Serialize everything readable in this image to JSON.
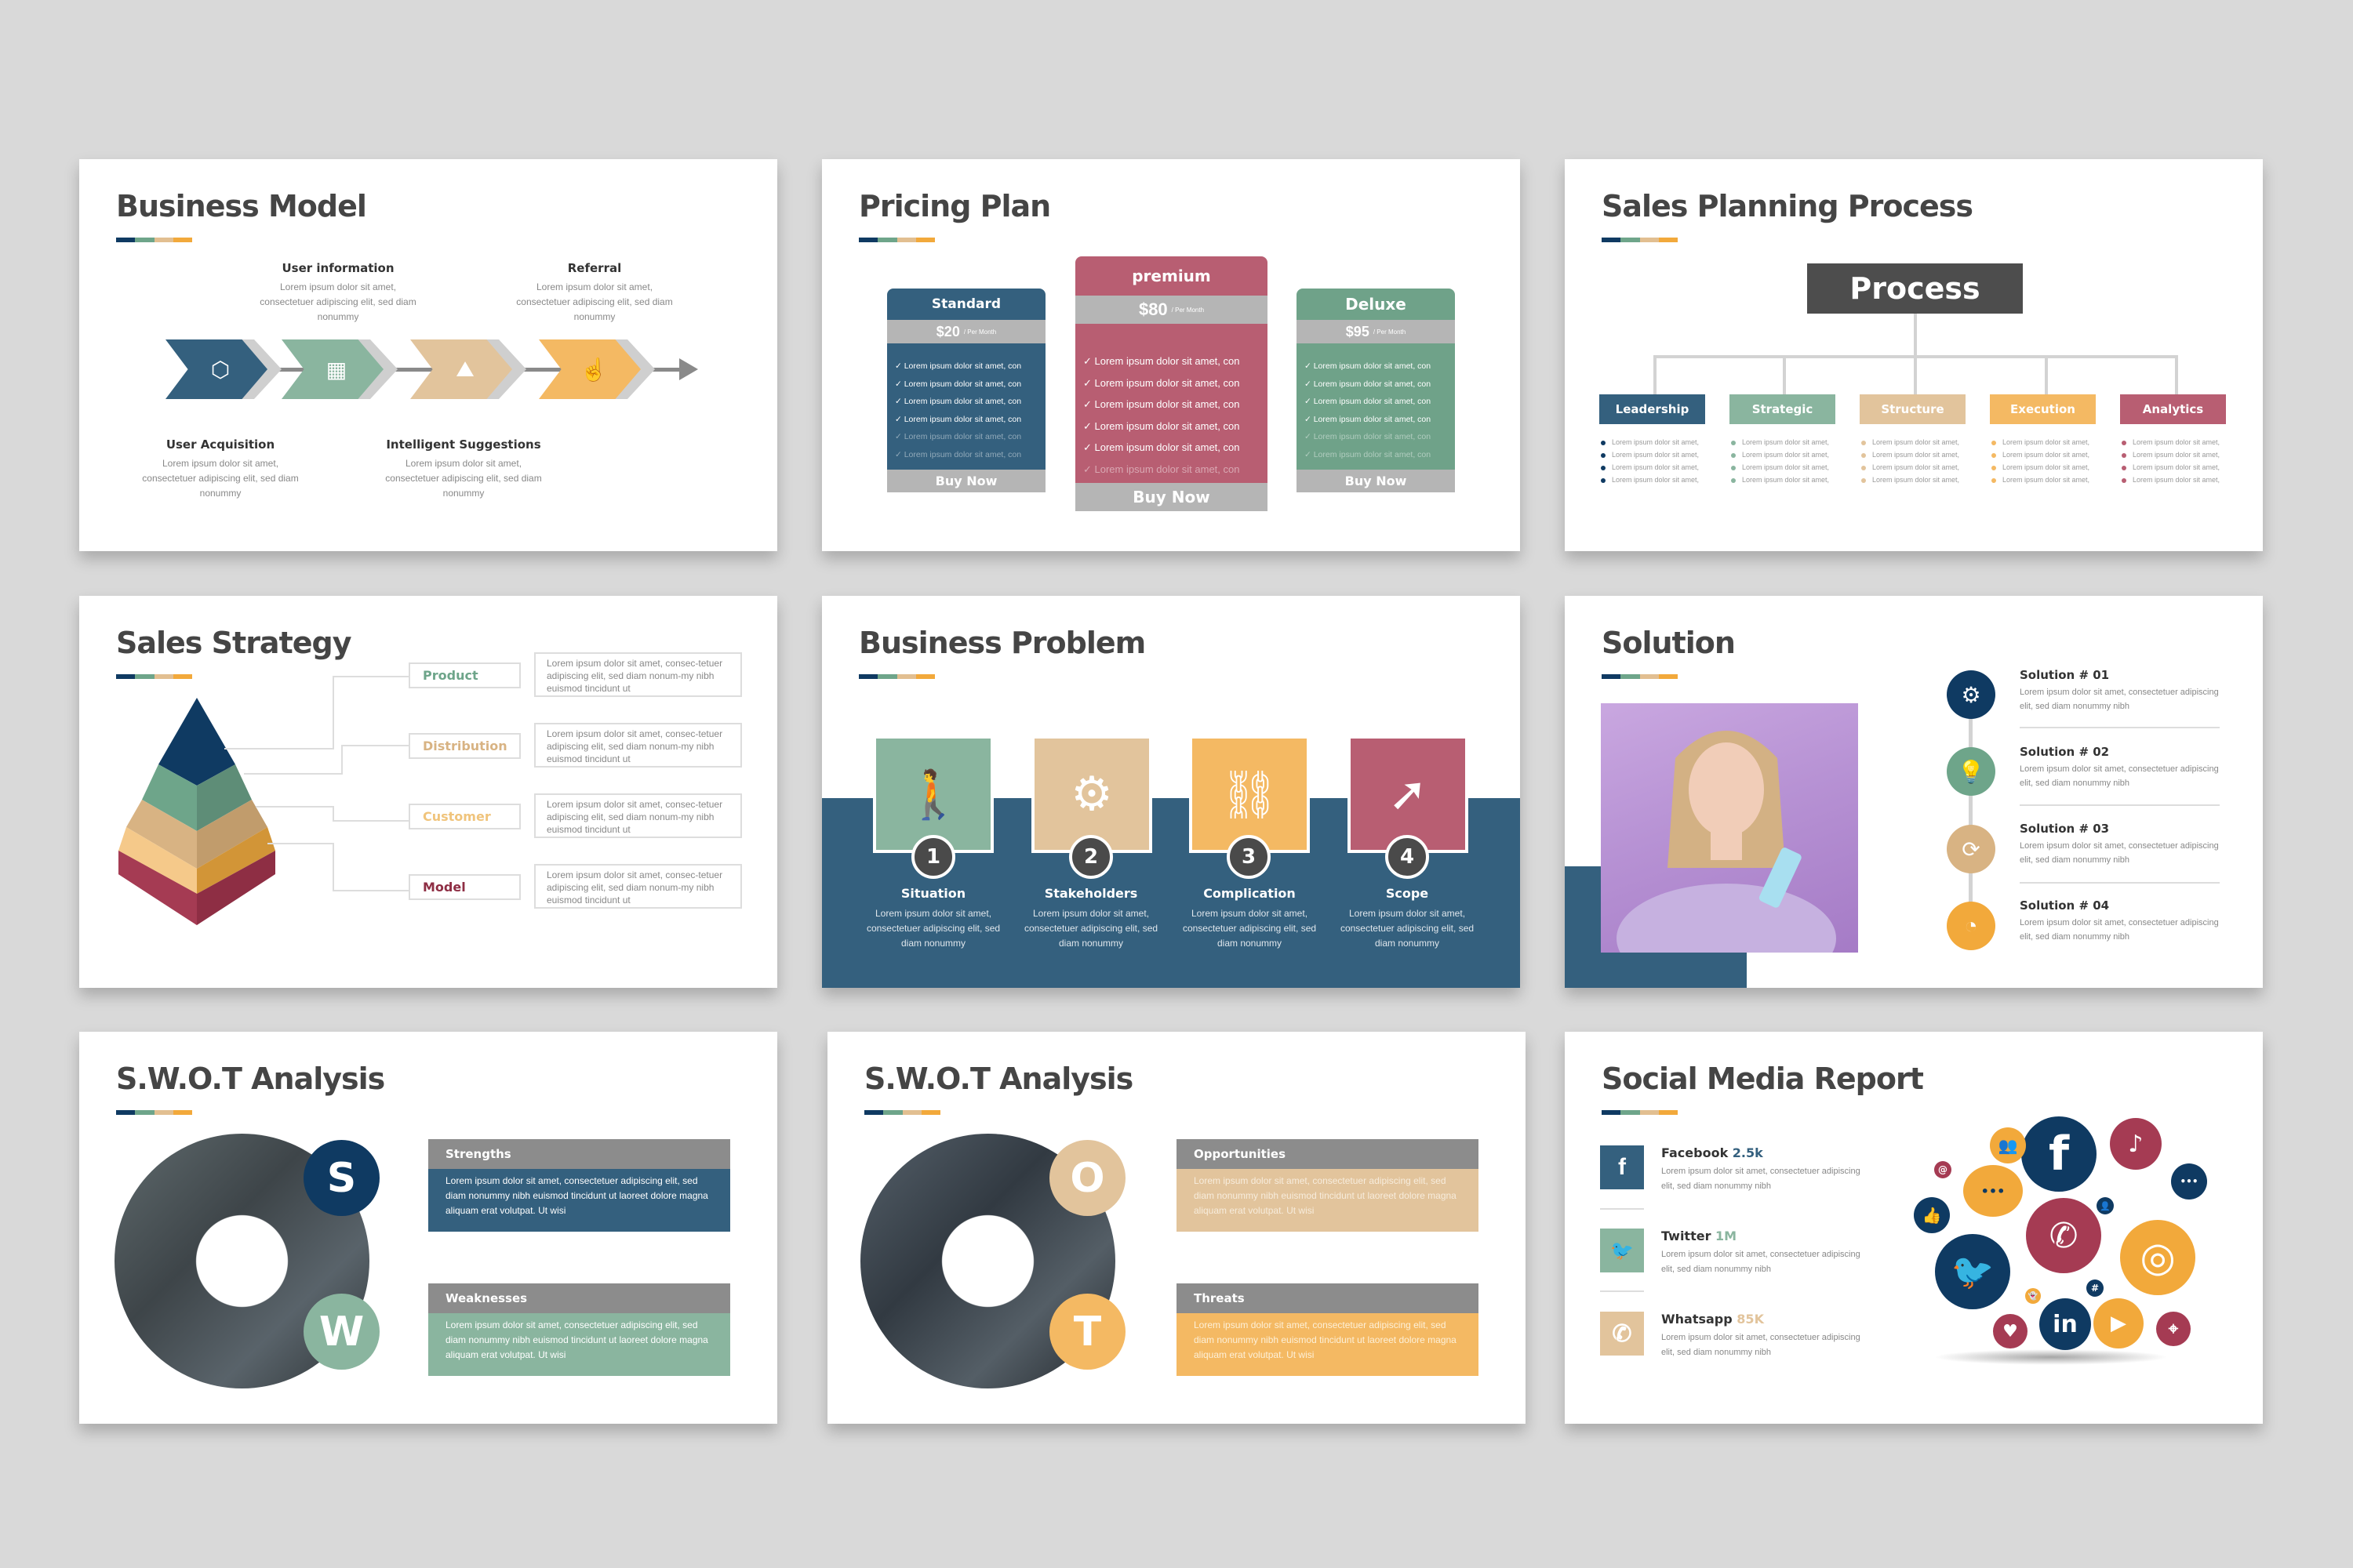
{
  "palette": {
    "navy": "#0f3a62",
    "steel": "#34607e",
    "sage": "#8ab59f",
    "sand": "#e2c49c",
    "amber": "#f4b963",
    "rose": "#b85e72",
    "gray": "#8c8c8c",
    "dark": "#454545"
  },
  "slides": {
    "business_model": {
      "title": "Business Model",
      "steps": [
        {
          "heading": "User Acquisition",
          "text": "Lorem ipsum dolor sit amet, consectetuer adipiscing elit, sed diam nonummy",
          "icon": "box-distribution-icon"
        },
        {
          "heading": "User information",
          "text": "Lorem ipsum dolor sit amet, consectetuer adipiscing elit, sed diam nonummy",
          "icon": "hand-package-icon"
        },
        {
          "heading": "Intelligent Suggestions",
          "text": "Lorem ipsum dolor sit amet, consectetuer adipiscing elit, sed diam nonummy",
          "icon": "mountain-flag-icon"
        },
        {
          "heading": "Referral",
          "text": "Lorem ipsum dolor sit amet, consectetuer adipiscing elit, sed diam nonummy",
          "icon": "touch-hand-icon"
        }
      ]
    },
    "pricing_plan": {
      "title": "Pricing Plan",
      "plans": [
        {
          "name": "Standard",
          "price": "$20",
          "period": "/ Per Month",
          "features": [
            "Lorem ipsum dolor sit amet, con",
            "Lorem ipsum dolor sit amet, con",
            "Lorem ipsum dolor sit amet, con",
            "Lorem ipsum dolor sit amet, con",
            "Lorem ipsum dolor sit amet, con",
            "Lorem ipsum dolor sit amet, con"
          ],
          "cta": "Buy Now"
        },
        {
          "name": "premium",
          "price": "$80",
          "period": "/ Per Month",
          "features": [
            "Lorem ipsum dolor sit amet, con",
            "Lorem ipsum dolor sit amet, con",
            "Lorem ipsum dolor sit amet, con",
            "Lorem ipsum dolor sit amet, con",
            "Lorem ipsum dolor sit amet, con",
            "Lorem ipsum dolor sit amet, con"
          ],
          "cta": "Buy Now"
        },
        {
          "name": "Deluxe",
          "price": "$95",
          "period": "/ Per Month",
          "features": [
            "Lorem ipsum dolor sit amet, con",
            "Lorem ipsum dolor sit amet, con",
            "Lorem ipsum dolor sit amet, con",
            "Lorem ipsum dolor sit amet, con",
            "Lorem ipsum dolor sit amet, con",
            "Lorem ipsum dolor sit amet, con"
          ],
          "cta": "Buy Now"
        }
      ]
    },
    "sales_planning": {
      "title": "Sales Planning Process",
      "root": "Process",
      "branches": [
        {
          "label": "Leadership",
          "items": [
            "Lorem ipsum dolor sit amet,",
            "Lorem ipsum dolor sit amet,",
            "Lorem ipsum dolor sit amet,",
            "Lorem ipsum dolor sit amet,"
          ]
        },
        {
          "label": "Strategic",
          "items": [
            "Lorem ipsum dolor sit amet,",
            "Lorem ipsum dolor sit amet,",
            "Lorem ipsum dolor sit amet,",
            "Lorem ipsum dolor sit amet,"
          ]
        },
        {
          "label": "Structure",
          "items": [
            "Lorem ipsum dolor sit amet,",
            "Lorem ipsum dolor sit amet,",
            "Lorem ipsum dolor sit amet,",
            "Lorem ipsum dolor sit amet,"
          ]
        },
        {
          "label": "Execution",
          "items": [
            "Lorem ipsum dolor sit amet,",
            "Lorem ipsum dolor sit amet,",
            "Lorem ipsum dolor sit amet,",
            "Lorem ipsum dolor sit amet,"
          ]
        },
        {
          "label": "Analytics",
          "items": [
            "Lorem ipsum dolor sit amet,",
            "Lorem ipsum dolor sit amet,",
            "Lorem ipsum dolor sit amet,",
            "Lorem ipsum dolor sit amet,"
          ]
        }
      ]
    },
    "sales_strategy": {
      "title": "Sales Strategy",
      "levels": [
        {
          "label": "Product",
          "text": "Lorem ipsum dolor sit amet, consec-tetuer adipiscing elit, sed diam nonum-my nibh euismod tincidunt ut"
        },
        {
          "label": "Distribution",
          "text": "Lorem ipsum dolor sit amet, consec-tetuer adipiscing elit, sed diam nonum-my nibh euismod tincidunt ut"
        },
        {
          "label": "Customer",
          "text": "Lorem ipsum dolor sit amet, consec-tetuer adipiscing elit, sed diam nonum-my nibh euismod tincidunt ut"
        },
        {
          "label": "Model",
          "text": "Lorem ipsum dolor sit amet, consec-tetuer adipiscing elit, sed diam nonum-my nibh euismod tincidunt ut"
        }
      ]
    },
    "business_problem": {
      "title": "Business Problem",
      "items": [
        {
          "num": "1",
          "heading": "Situation",
          "text": "Lorem ipsum dolor sit amet, consectetuer adipiscing elit, sed diam nonummy",
          "icon": "tired-person-icon"
        },
        {
          "num": "2",
          "heading": "Stakeholders",
          "text": "Lorem ipsum dolor sit amet, consectetuer adipiscing elit, sed diam nonummy",
          "icon": "broken-gear-icon"
        },
        {
          "num": "3",
          "heading": "Complication",
          "text": "Lorem ipsum dolor sit amet, consectetuer adipiscing elit, sed diam nonummy",
          "icon": "broken-chain-icon"
        },
        {
          "num": "4",
          "heading": "Scope",
          "text": "Lorem ipsum dolor sit amet, consectetuer adipiscing elit, sed diam nonummy",
          "icon": "broken-arrow-icon"
        }
      ]
    },
    "solution": {
      "title": "Solution",
      "items": [
        {
          "heading": "Solution # 01",
          "text": "Lorem ipsum dolor sit amet, consectetuer adipiscing elit, sed diam nonummy nibh",
          "icon": "gear-wrench-icon"
        },
        {
          "heading": "Solution # 02",
          "text": "Lorem ipsum dolor sit amet, consectetuer adipiscing elit, sed diam nonummy nibh",
          "icon": "lightbulb-puzzle-icon"
        },
        {
          "heading": "Solution # 03",
          "text": "Lorem ipsum dolor sit amet, consectetuer adipiscing elit, sed diam nonummy nibh",
          "icon": "gear-cycle-icon"
        },
        {
          "heading": "Solution # 04",
          "text": "Lorem ipsum dolor sit amet, consectetuer adipiscing elit, sed diam nonummy nibh",
          "icon": "chart-donut-icon"
        }
      ]
    },
    "swot_sw": {
      "title": "S.W.O.T Analysis",
      "letters": [
        "S",
        "W"
      ],
      "boxes": [
        {
          "heading": "Strengths",
          "text": "Lorem ipsum dolor sit amet, consectetuer adipiscing elit, sed diam nonummy nibh euismod tincidunt ut laoreet dolore magna aliquam erat volutpat. Ut wisi"
        },
        {
          "heading": "Weaknesses",
          "text": "Lorem ipsum dolor sit amet, consectetuer adipiscing elit, sed diam nonummy nibh euismod tincidunt ut laoreet dolore magna aliquam erat volutpat. Ut wisi"
        }
      ]
    },
    "swot_ot": {
      "title": "S.W.O.T Analysis",
      "letters": [
        "O",
        "T"
      ],
      "boxes": [
        {
          "heading": "Opportunities",
          "text": "Lorem ipsum dolor sit amet, consectetuer adipiscing elit, sed diam nonummy nibh euismod tincidunt ut laoreet dolore magna aliquam erat volutpat. Ut wisi"
        },
        {
          "heading": "Threats",
          "text": "Lorem ipsum dolor sit amet, consectetuer adipiscing elit, sed diam nonummy nibh euismod tincidunt ut laoreet dolore magna aliquam erat volutpat. Ut wisi"
        }
      ]
    },
    "social_media": {
      "title": "Social Media Report",
      "channels": [
        {
          "name": "Facebook",
          "value": "2.5k",
          "text": "Lorem ipsum dolor sit amet, consectetuer adipiscing elit, sed diam nonummy nibh",
          "icon_glyph": "f"
        },
        {
          "name": "Twitter",
          "value": "1M",
          "text": "Lorem ipsum dolor sit amet, consectetuer adipiscing elit, sed diam nonummy nibh",
          "icon_glyph": "🐦"
        },
        {
          "name": "Whatsapp",
          "value": "85K",
          "text": "Lorem ipsum dolor sit amet, consectetuer adipiscing elit, sed diam nonummy nibh",
          "icon_glyph": "✆"
        }
      ],
      "cluster_glyphs": {
        "facebook": "f",
        "tiktok": "♪",
        "whatsapp": "✆",
        "twitter": "🐦",
        "instagram": "◎",
        "linkedin": "in",
        "play": "▶",
        "heart": "♥",
        "pin": "⌖",
        "like": "👍",
        "chat": "•••",
        "at": "@",
        "hash": "#",
        "users": "👥",
        "user": "👤",
        "ghost": "👻"
      }
    }
  }
}
